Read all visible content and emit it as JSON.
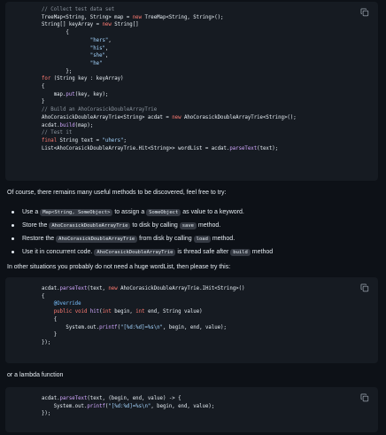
{
  "block1": {
    "lines": [
      [
        {
          "t": "// Collect test data set",
          "c": "cm"
        }
      ],
      [
        {
          "t": "TreeMap<String, String> map = "
        },
        {
          "t": "new",
          "c": "kw"
        },
        {
          "t": " TreeMap<String, String>();"
        }
      ],
      [
        {
          "t": "String[] keyArray = "
        },
        {
          "t": "new",
          "c": "kw"
        },
        {
          "t": " String[]"
        }
      ],
      [
        {
          "t": "        {"
        }
      ],
      [
        {
          "t": "                "
        },
        {
          "t": "\"hers\"",
          "c": "st"
        },
        {
          "t": ","
        }
      ],
      [
        {
          "t": "                "
        },
        {
          "t": "\"his\"",
          "c": "st"
        },
        {
          "t": ","
        }
      ],
      [
        {
          "t": "                "
        },
        {
          "t": "\"she\"",
          "c": "st"
        },
        {
          "t": ","
        }
      ],
      [
        {
          "t": "                "
        },
        {
          "t": "\"he\"",
          "c": "st"
        }
      ],
      [
        {
          "t": "        };"
        }
      ],
      [
        {
          "t": "for",
          "c": "kw"
        },
        {
          "t": " (String key : keyArray)"
        }
      ],
      [
        {
          "t": "{"
        }
      ],
      [
        {
          "t": "    map."
        },
        {
          "t": "put",
          "c": "fn"
        },
        {
          "t": "(key, key);"
        }
      ],
      [
        {
          "t": "}"
        }
      ],
      [
        {
          "t": "// Build an AhoCorasickDoubleArrayTrie",
          "c": "cm"
        }
      ],
      [
        {
          "t": "AhoCorasickDoubleArrayTrie<String> acdat = "
        },
        {
          "t": "new",
          "c": "kw"
        },
        {
          "t": " AhoCorasickDoubleArrayTrie<String>();"
        }
      ],
      [
        {
          "t": "acdat."
        },
        {
          "t": "build",
          "c": "fn"
        },
        {
          "t": "(map);"
        }
      ],
      [
        {
          "t": "// Test it",
          "c": "cm"
        }
      ],
      [
        {
          "t": "final",
          "c": "kw"
        },
        {
          "t": " String text = "
        },
        {
          "t": "\"uhers\"",
          "c": "st"
        },
        {
          "t": ";"
        }
      ],
      [
        {
          "t": "List<AhoCorasickDoubleArrayTrie.Hit<String>> wordList = acdat."
        },
        {
          "t": "parseText",
          "c": "fn"
        },
        {
          "t": "(text);"
        }
      ]
    ]
  },
  "para1": "Of course, there remains many useful methods to be discovered, feel free to try:",
  "bullets": [
    [
      {
        "t": "Use a "
      },
      {
        "t": "Map<String, SomeObject>",
        "code": true
      },
      {
        "t": " to assign a "
      },
      {
        "t": "SomeObject",
        "code": true
      },
      {
        "t": " as value to a keyword."
      }
    ],
    [
      {
        "t": "Store the "
      },
      {
        "t": "AhoCorasickDoubleArrayTrie",
        "code": true
      },
      {
        "t": " to disk by calling "
      },
      {
        "t": "save",
        "code": true
      },
      {
        "t": " method."
      }
    ],
    [
      {
        "t": "Restore the "
      },
      {
        "t": "AhoCorasickDoubleArrayTrie",
        "code": true
      },
      {
        "t": " from disk by calling "
      },
      {
        "t": "load",
        "code": true
      },
      {
        "t": " method."
      }
    ],
    [
      {
        "t": "Use it in concurrent code. "
      },
      {
        "t": "AhoCorasickDoubleArrayTrie",
        "code": true
      },
      {
        "t": " is thread safe after "
      },
      {
        "t": "build",
        "code": true
      },
      {
        "t": " method"
      }
    ]
  ],
  "para2": "In other situations you probably do not need a huge wordList, then please try this:",
  "block2": {
    "lines": [
      [
        {
          "t": "acdat."
        },
        {
          "t": "parseText",
          "c": "fn"
        },
        {
          "t": "(text, "
        },
        {
          "t": "new",
          "c": "kw"
        },
        {
          "t": " AhoCorasickDoubleArrayTrie.IHit<String>()"
        }
      ],
      [
        {
          "t": "{"
        }
      ],
      [
        {
          "t": "    "
        },
        {
          "t": "@Override",
          "c": "an"
        }
      ],
      [
        {
          "t": "    "
        },
        {
          "t": "public",
          "c": "kw"
        },
        {
          "t": " "
        },
        {
          "t": "void",
          "c": "kw"
        },
        {
          "t": " "
        },
        {
          "t": "hit",
          "c": "fn"
        },
        {
          "t": "("
        },
        {
          "t": "int",
          "c": "kw"
        },
        {
          "t": " begin, "
        },
        {
          "t": "int",
          "c": "kw"
        },
        {
          "t": " end, String value)"
        }
      ],
      [
        {
          "t": "    {"
        }
      ],
      [
        {
          "t": "        System.out."
        },
        {
          "t": "printf",
          "c": "fn"
        },
        {
          "t": "("
        },
        {
          "t": "\"[%d:%d]=%s\\n\"",
          "c": "st"
        },
        {
          "t": ", begin, end, value);"
        }
      ],
      [
        {
          "t": "    }"
        }
      ],
      [
        {
          "t": "});"
        }
      ]
    ]
  },
  "para3": "or a lambda function",
  "block3": {
    "lines": [
      [
        {
          "t": "acdat."
        },
        {
          "t": "parseText",
          "c": "fn"
        },
        {
          "t": "(text, (begin, end, value) -> {"
        }
      ],
      [
        {
          "t": "    System.out."
        },
        {
          "t": "printf",
          "c": "fn"
        },
        {
          "t": "("
        },
        {
          "t": "\"[%d:%d]=%s\\n\"",
          "c": "st"
        },
        {
          "t": ", begin, end, value);"
        }
      ],
      [
        {
          "t": "});"
        }
      ]
    ]
  },
  "icons": {
    "copy": "copy-icon"
  }
}
